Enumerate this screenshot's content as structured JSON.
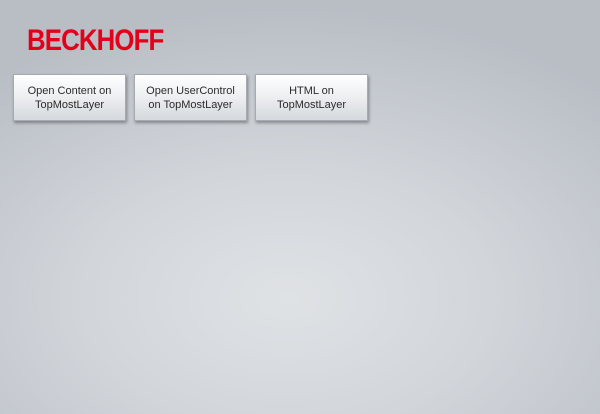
{
  "brand": {
    "logo_text": "BECKHOFF",
    "color": "#e2001a"
  },
  "buttons": [
    {
      "label": "Open Content on TopMostLayer"
    },
    {
      "label": "Open UserControl on TopMostLayer"
    },
    {
      "label": "HTML on TopMostLayer"
    }
  ]
}
